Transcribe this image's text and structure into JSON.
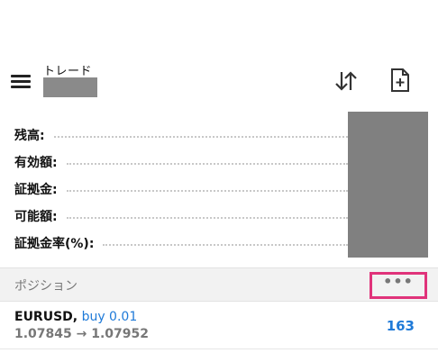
{
  "header": {
    "title": "トレード",
    "icons": {
      "menu": "hamburger-menu-icon",
      "sort": "sort-arrows-icon",
      "new_order": "new-document-plus-icon"
    }
  },
  "summary": {
    "rows": [
      {
        "label": "残高:"
      },
      {
        "label": "有効額:"
      },
      {
        "label": "証拠金:"
      },
      {
        "label": "可能額:"
      },
      {
        "label": "証拠金率(%):"
      }
    ]
  },
  "positions": {
    "section_title": "ポジション",
    "more_label": "•••",
    "items": [
      {
        "symbol": "EURUSD,",
        "trade": "buy 0.01",
        "prices": "1.07845 → 1.07952",
        "profit": "163"
      }
    ]
  },
  "colors": {
    "accent_blue": "#1f7ad8",
    "highlight_pink": "#e0337a",
    "redaction_gray": "#808080"
  }
}
